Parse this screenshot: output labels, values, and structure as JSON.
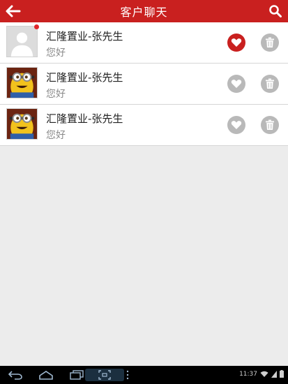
{
  "header": {
    "title": "客户聊天",
    "back_icon": "arrow-left-icon",
    "search_icon": "search-icon"
  },
  "conversations": [
    {
      "name": "汇隆置业-张先生",
      "message": "您好",
      "avatar": "default-person-avatar",
      "unread": true,
      "favorited": true
    },
    {
      "name": "汇隆置业-张先生",
      "message": "您好",
      "avatar": "minion-avatar",
      "unread": false,
      "favorited": false
    },
    {
      "name": "汇隆置业-张先生",
      "message": "您好",
      "avatar": "minion-avatar",
      "unread": false,
      "favorited": false
    }
  ],
  "system_bar": {
    "time": "11:37",
    "icons": [
      "back-icon",
      "home-icon",
      "recent-apps-icon",
      "screenshot-icon",
      "menu-dots-icon",
      "wifi-icon",
      "signal-icon",
      "battery-icon"
    ]
  },
  "colors": {
    "accent": "#c9201f",
    "inactive_icon": "#b9b9b9",
    "background": "#ececec"
  }
}
